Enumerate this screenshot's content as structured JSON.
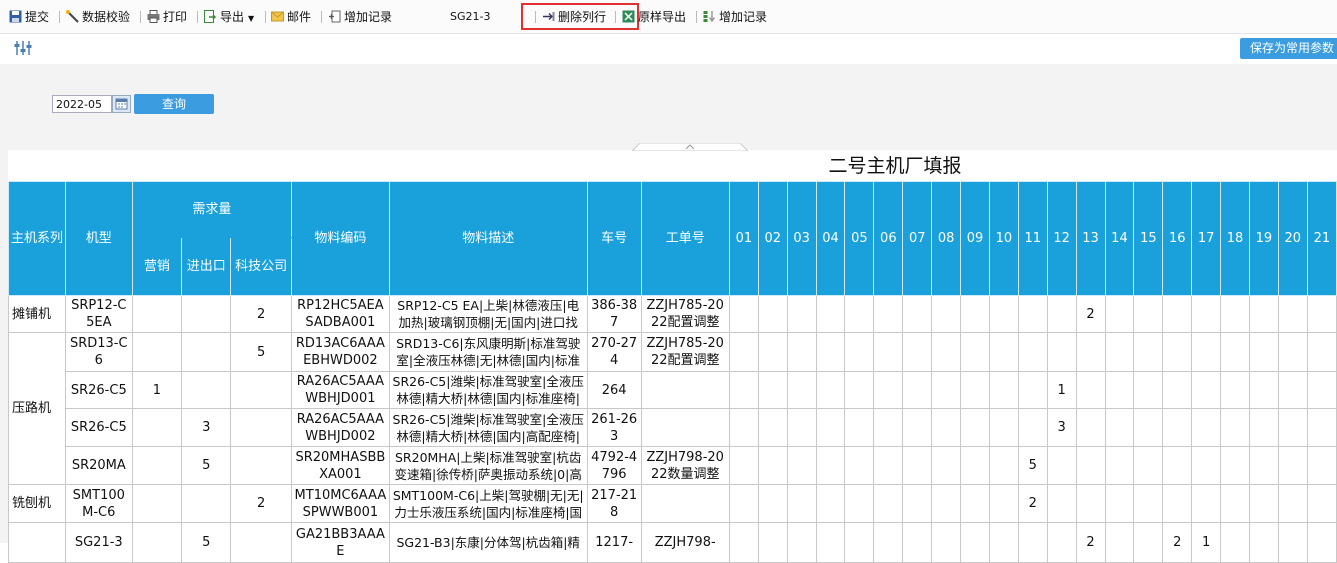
{
  "toolbar": {
    "submit": "提交",
    "validate": "数据校验",
    "print": "打印",
    "export": "导出",
    "mail": "邮件",
    "add_record": "增加记录",
    "report_code": "SG21-3",
    "delete_row": "删除列行",
    "sample_export": "原样导出",
    "add_record2": "增加记录"
  },
  "bar2": {
    "save_params": "保存为常用参数"
  },
  "filter": {
    "date_value": "2022-05",
    "query": "查询"
  },
  "report": {
    "title": "二号主机厂填报",
    "headers": {
      "series": "主机系列",
      "model": "机型",
      "demand": "需求量",
      "sales": "营销",
      "import_export": "进出口",
      "tech_company": "科技公司",
      "material_code": "物料编码",
      "material_desc": "物料描述",
      "vehicle_no": "车号",
      "order_no": "工单号",
      "days": [
        "01",
        "02",
        "03",
        "04",
        "05",
        "06",
        "07",
        "08",
        "09",
        "10",
        "11",
        "12",
        "13",
        "14",
        "15",
        "16",
        "17",
        "18",
        "19",
        "20",
        "21"
      ]
    },
    "rows": [
      {
        "series": "摊铺机",
        "model": "SRP12-C5EA",
        "sales": "",
        "ie": "",
        "tech": "2",
        "code": "RP12HC5AEASADBA001",
        "desc": "SRP12-C5 EA|上柴|林德液压|电加热|玻璃钢顶棚|无|国内|进口找",
        "car": "386-387",
        "order": "ZZJH785-2022配置调整",
        "days": {
          "13": "2"
        }
      },
      {
        "series": "",
        "model": "SRD13-C6",
        "sales": "",
        "ie": "",
        "tech": "5",
        "code": "RD13AC6AAAEBHWD002",
        "desc": "SRD13-C6|东风康明斯|标准驾驶室|全液压林德|无|林德|国内|标准",
        "car": "270-274",
        "order": "ZZJH785-2022配置调整",
        "days": {}
      },
      {
        "series": "",
        "model": "SR26-C5",
        "sales": "1",
        "ie": "",
        "tech": "",
        "code": "RA26AC5AAAWBHJD001",
        "desc": "SR26-C5|潍柴|标准驾驶室|全液压林德|精大桥|林德|国内|标准座椅|",
        "car": "264",
        "order": "",
        "days": {
          "12": "1"
        }
      },
      {
        "series": "",
        "model": "SR26-C5",
        "sales": "",
        "ie": "3",
        "tech": "",
        "code": "RA26AC5AAAWBHJD002",
        "desc": "SR26-C5|潍柴|标准驾驶室|全液压林德|精大桥|林德|国内|高配座椅|",
        "car": "261-263",
        "order": "",
        "days": {
          "12": "3"
        }
      },
      {
        "series": "",
        "model": "SR20MA",
        "sales": "",
        "ie": "5",
        "tech": "",
        "code": "SR20MHASBBXA001",
        "desc": "SR20MHA|上柴|标准驾驶室|杭齿变速箱|徐传桥|萨奥振动系统|0|高",
        "car": "4792-4796",
        "order": "ZZJH798-2022数量调整",
        "days": {
          "11": "5"
        }
      },
      {
        "series": "铣刨机",
        "model": "SMT100M-C6",
        "sales": "",
        "ie": "",
        "tech": "2",
        "code": "MT10MC6AAASPWWB001",
        "desc": "SMT100M-C6|上柴|驾驶棚|无|无|力士乐液压系统|国内|标准座椅|国",
        "car": "217-218",
        "order": "",
        "days": {
          "11": "2"
        }
      },
      {
        "series": "",
        "model": "SG21-3",
        "sales": "",
        "ie": "5",
        "tech": "",
        "code": "GA21BB3AAAE",
        "desc": "SG21-B3|东康|分体驾|杭齿箱|精",
        "car": "1217-",
        "order": "ZZJH798-",
        "days": {
          "13": "2",
          "16": "2",
          "17": "1"
        }
      }
    ],
    "merged_series_roller": "压路机"
  }
}
